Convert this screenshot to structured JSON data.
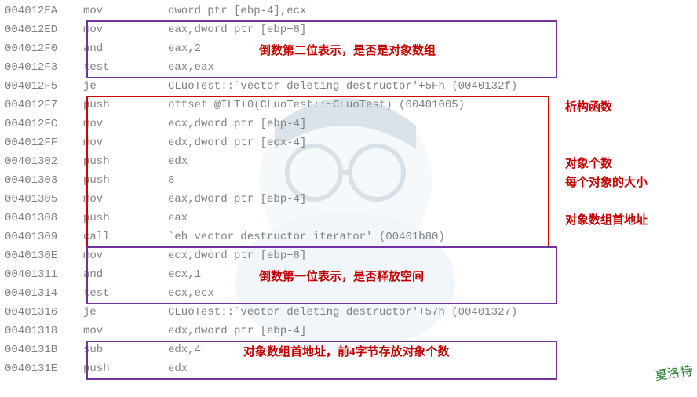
{
  "rows": [
    {
      "addr": "004012EA",
      "mnem": "mov",
      "ops": "dword ptr [ebp-4],ecx"
    },
    {
      "addr": "004012ED",
      "mnem": "mov",
      "ops": "eax,dword ptr [ebp+8]"
    },
    {
      "addr": "004012F0",
      "mnem": "and",
      "ops": "eax,2"
    },
    {
      "addr": "004012F3",
      "mnem": "test",
      "ops": "eax,eax"
    },
    {
      "addr": "004012F5",
      "mnem": "je",
      "ops": "CLuoTest::`vector deleting destructor'+5Fh (0040132f)"
    },
    {
      "addr": "004012F7",
      "mnem": "push",
      "ops": "offset @ILT+0(CLuoTest::~CLuoTest) (00401005)"
    },
    {
      "addr": "004012FC",
      "mnem": "mov",
      "ops": "ecx,dword ptr [ebp-4]"
    },
    {
      "addr": "004012FF",
      "mnem": "mov",
      "ops": "edx,dword ptr [ecx-4]"
    },
    {
      "addr": "00401302",
      "mnem": "push",
      "ops": "edx"
    },
    {
      "addr": "00401303",
      "mnem": "push",
      "ops": "8"
    },
    {
      "addr": "00401305",
      "mnem": "mov",
      "ops": "eax,dword ptr [ebp-4]"
    },
    {
      "addr": "00401308",
      "mnem": "push",
      "ops": "eax"
    },
    {
      "addr": "00401309",
      "mnem": "call",
      "ops": "`eh vector destructor iterator' (00401b80)"
    },
    {
      "addr": "0040130E",
      "mnem": "mov",
      "ops": "ecx,dword ptr [ebp+8]"
    },
    {
      "addr": "00401311",
      "mnem": "and",
      "ops": "ecx,1"
    },
    {
      "addr": "00401314",
      "mnem": "test",
      "ops": "ecx,ecx"
    },
    {
      "addr": "00401316",
      "mnem": "je",
      "ops": "CLuoTest::`vector deleting destructor'+57h (00401327)"
    },
    {
      "addr": "00401318",
      "mnem": "mov",
      "ops": "edx,dword ptr [ebp-4]"
    },
    {
      "addr": "0040131B",
      "mnem": "sub",
      "ops": "edx,4"
    },
    {
      "addr": "0040131E",
      "mnem": "push",
      "ops": "edx"
    }
  ],
  "annotations": {
    "a1": "倒数第二位表示，是否是对象数组",
    "a2": "析构函数",
    "a3": "对象个数",
    "a4": "每个对象的大小",
    "a5": "对象数组首地址",
    "a6": "倒数第一位表示，是否释放空间",
    "a7": "对象数组首地址，前4字节存放对象个数"
  },
  "signature": "夏洛特"
}
